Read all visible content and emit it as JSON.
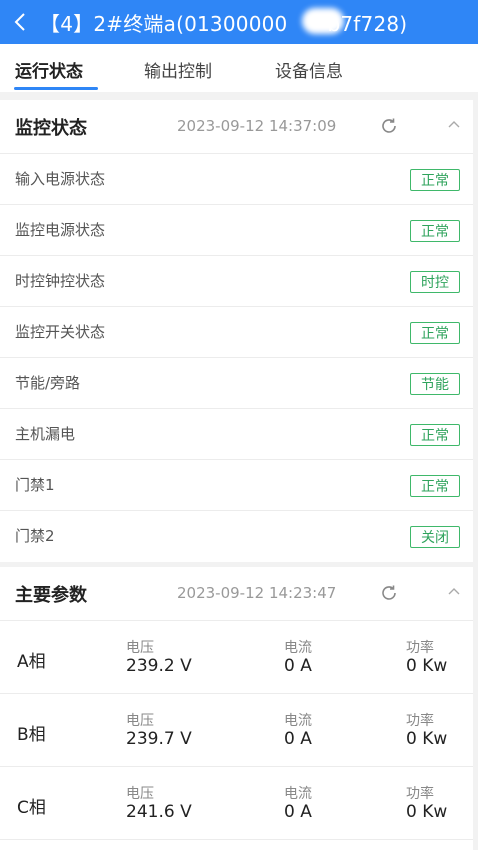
{
  "header": {
    "title": "【4】2#终端a(01300000",
    "title_tail": "b7f728)"
  },
  "tabs": [
    {
      "label": "运行状态",
      "active": true
    },
    {
      "label": "输出控制",
      "active": false
    },
    {
      "label": "设备信息",
      "active": false
    }
  ],
  "monitor": {
    "title": "监控状态",
    "time": "2023-09-12 14:37:09",
    "rows": [
      {
        "label": "输入电源状态",
        "status": "正常"
      },
      {
        "label": "监控电源状态",
        "status": "正常"
      },
      {
        "label": "时控钟控状态",
        "status": "时控"
      },
      {
        "label": "监控开关状态",
        "status": "正常"
      },
      {
        "label": "节能/旁路",
        "status": "节能"
      },
      {
        "label": "主机漏电",
        "status": "正常"
      },
      {
        "label": "门禁1",
        "status": "正常"
      },
      {
        "label": "门禁2",
        "status": "关闭"
      }
    ]
  },
  "params": {
    "title": "主要参数",
    "time": "2023-09-12 14:23:47",
    "voltage_label": "电压",
    "current_label": "电流",
    "power_label": "功率",
    "rows": [
      {
        "phase": "A相",
        "voltage": "239.2 V",
        "current": "0 A",
        "power": "0 Kw"
      },
      {
        "phase": "B相",
        "voltage": "239.7 V",
        "current": "0 A",
        "power": "0 Kw"
      },
      {
        "phase": "C相",
        "voltage": "241.6 V",
        "current": "0 A",
        "power": "0 Kw"
      }
    ]
  },
  "colors": {
    "accent": "#2f86f6",
    "badge_green": "#3fb86a"
  },
  "icons": {
    "back": "chevron-left-icon",
    "refresh": "refresh-icon",
    "collapse": "chevron-up-icon"
  }
}
